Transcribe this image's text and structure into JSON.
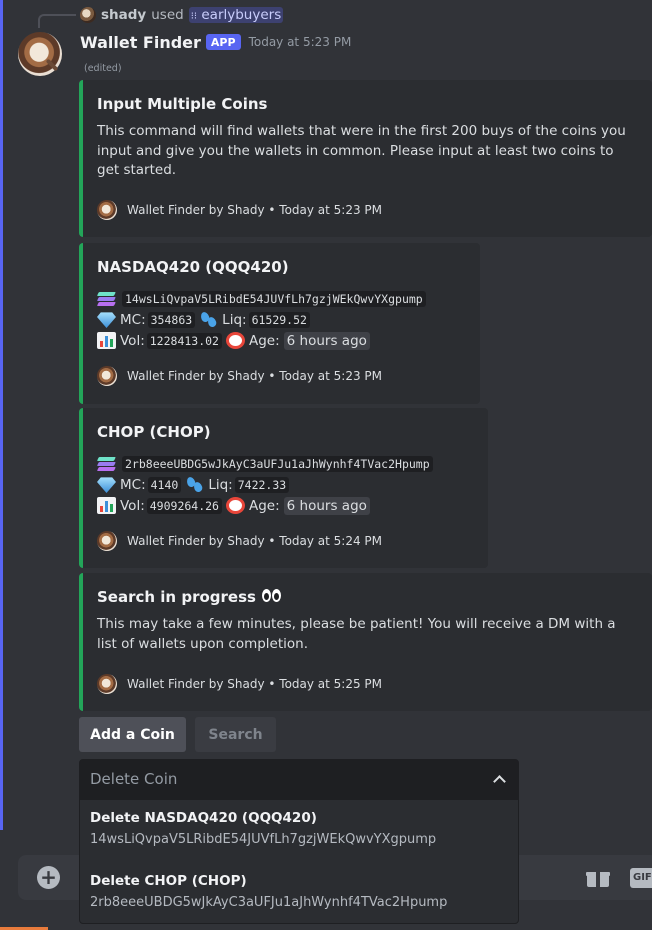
{
  "reply": {
    "username": "shady",
    "action": "used",
    "command": "earlybuyers"
  },
  "message": {
    "author": "Wallet Finder",
    "badge": "APP",
    "timestamp": "Today at 5:23 PM",
    "edited": "(edited)"
  },
  "embeds": [
    {
      "title": "Input Multiple Coins",
      "description": "This command will find wallets that were in the first 200 buys of the coins you input and give you the wallets in common. Please input at least two coins to get started.",
      "footer": "Wallet Finder by Shady • Today at 5:23 PM"
    },
    {
      "title": "NASDAQ420 (QQQ420)",
      "address": "14wsLiQvpaV5LRibdE54JUVfLh7gzjWEkQwvYXgpump",
      "mc_label": "MC:",
      "mc": "354863",
      "liq_label": "Liq:",
      "liq": "61529.52",
      "vol_label": "Vol:",
      "vol": "1228413.02",
      "age_label": "Age:",
      "age": "6 hours ago",
      "footer": "Wallet Finder by Shady • Today at 5:23 PM"
    },
    {
      "title": "CHOP (CHOP)",
      "address": "2rb8eeeUBDG5wJkAyC3aUFJu1aJhWynhf4TVac2Hpump",
      "mc_label": "MC:",
      "mc": "4140",
      "liq_label": "Liq:",
      "liq": "7422.33",
      "vol_label": "Vol:",
      "vol": "4909264.26",
      "age_label": "Age:",
      "age": "6 hours ago",
      "footer": "Wallet Finder by Shady • Today at 5:24 PM"
    },
    {
      "title": "Search in progress",
      "description": "This may take a few minutes, please be patient! You will receive a DM with a list of wallets upon completion.",
      "footer": "Wallet Finder by Shady • Today at 5:25 PM"
    }
  ],
  "buttons": {
    "add": "Add a Coin",
    "search": "Search"
  },
  "select": {
    "placeholder": "Delete Coin",
    "options": [
      {
        "label": "Delete NASDAQ420 (QQQ420)",
        "description": "14wsLiQvpaV5LRibdE54JUVfLh7gzjWEkQwvYXgpump"
      },
      {
        "label": "Delete CHOP (CHOP)",
        "description": "2rb8eeeUBDG5wJkAyC3aUFJu1aJhWynhf4TVac2Hpump"
      }
    ]
  },
  "composer": {
    "gif_label": "GIF"
  },
  "colors": {
    "embed_accent": "#23a559",
    "blurple": "#5865f2"
  }
}
